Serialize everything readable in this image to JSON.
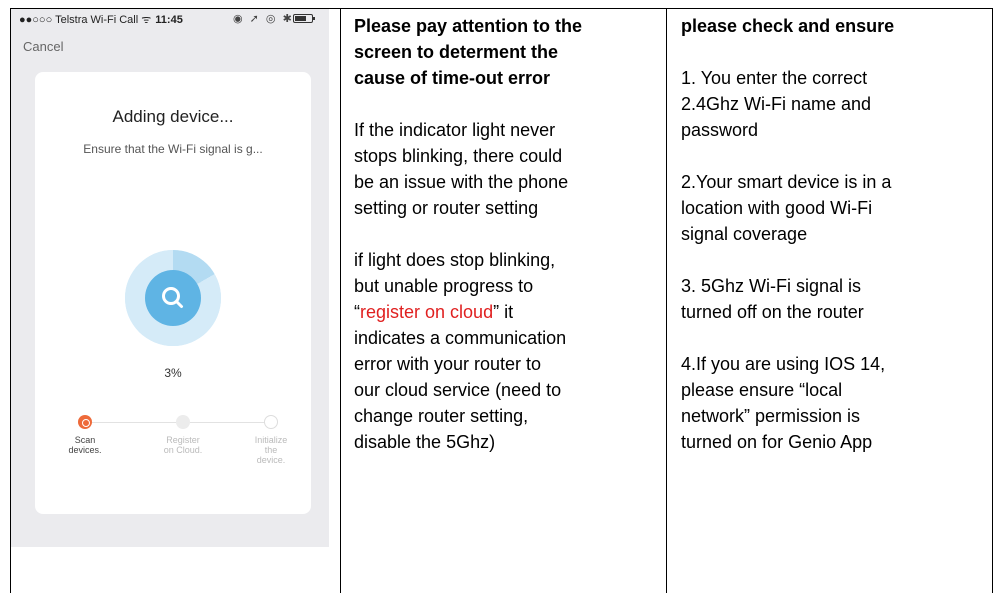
{
  "phone": {
    "status_carrier": "●●○○○ Telstra Wi-Fi Call ᯤ",
    "status_time": "11:45",
    "status_icons": "◉ ➚ ◎ ✱",
    "cancel_label": "Cancel",
    "title": "Adding device...",
    "subtitle": "Ensure that the Wi-Fi signal is g...",
    "progress_percent": "3%",
    "progress_value": 0.03,
    "steps": [
      {
        "label": "Scan\ndevices.",
        "state": "active"
      },
      {
        "label": "Register\non Cloud.",
        "state": "pending"
      },
      {
        "label": "Initialize\nthe\ndevice.",
        "state": "pending"
      }
    ],
    "colors": {
      "accent": "#5fb4e4",
      "active_step": "#ee6a3a",
      "ring": "#d5ebf8"
    }
  },
  "column2": {
    "heading": "Please pay attention to the\nscreen to determent the\ncause of time-out error",
    "para1": "If the indicator light never\nstops blinking, there could\nbe an issue with the phone\nsetting or router setting",
    "para2_start": "if light does stop blinking,\nbut unable progress to\n“",
    "para2_highlight": "register on cloud",
    "para2_mid": "”  it",
    "para2_end": "\nindicates a communication\nerror with your router to\nour cloud service (need to\nchange router setting,\ndisable the 5Ghz)",
    "highlight_color": "#e02020"
  },
  "column3": {
    "heading": "please check and ensure",
    "item1": "1. You enter the correct\n2.4Ghz Wi-Fi name and\npassword",
    "item2": "2.Your smart device is in a\nlocation with good Wi-Fi\nsignal coverage",
    "item3": "3. 5Ghz Wi-Fi signal is\nturned off on the router",
    "item4": "4.If you are using IOS 14,\nplease ensure “local\nnetwork” permission is\nturned on for Genio App"
  }
}
